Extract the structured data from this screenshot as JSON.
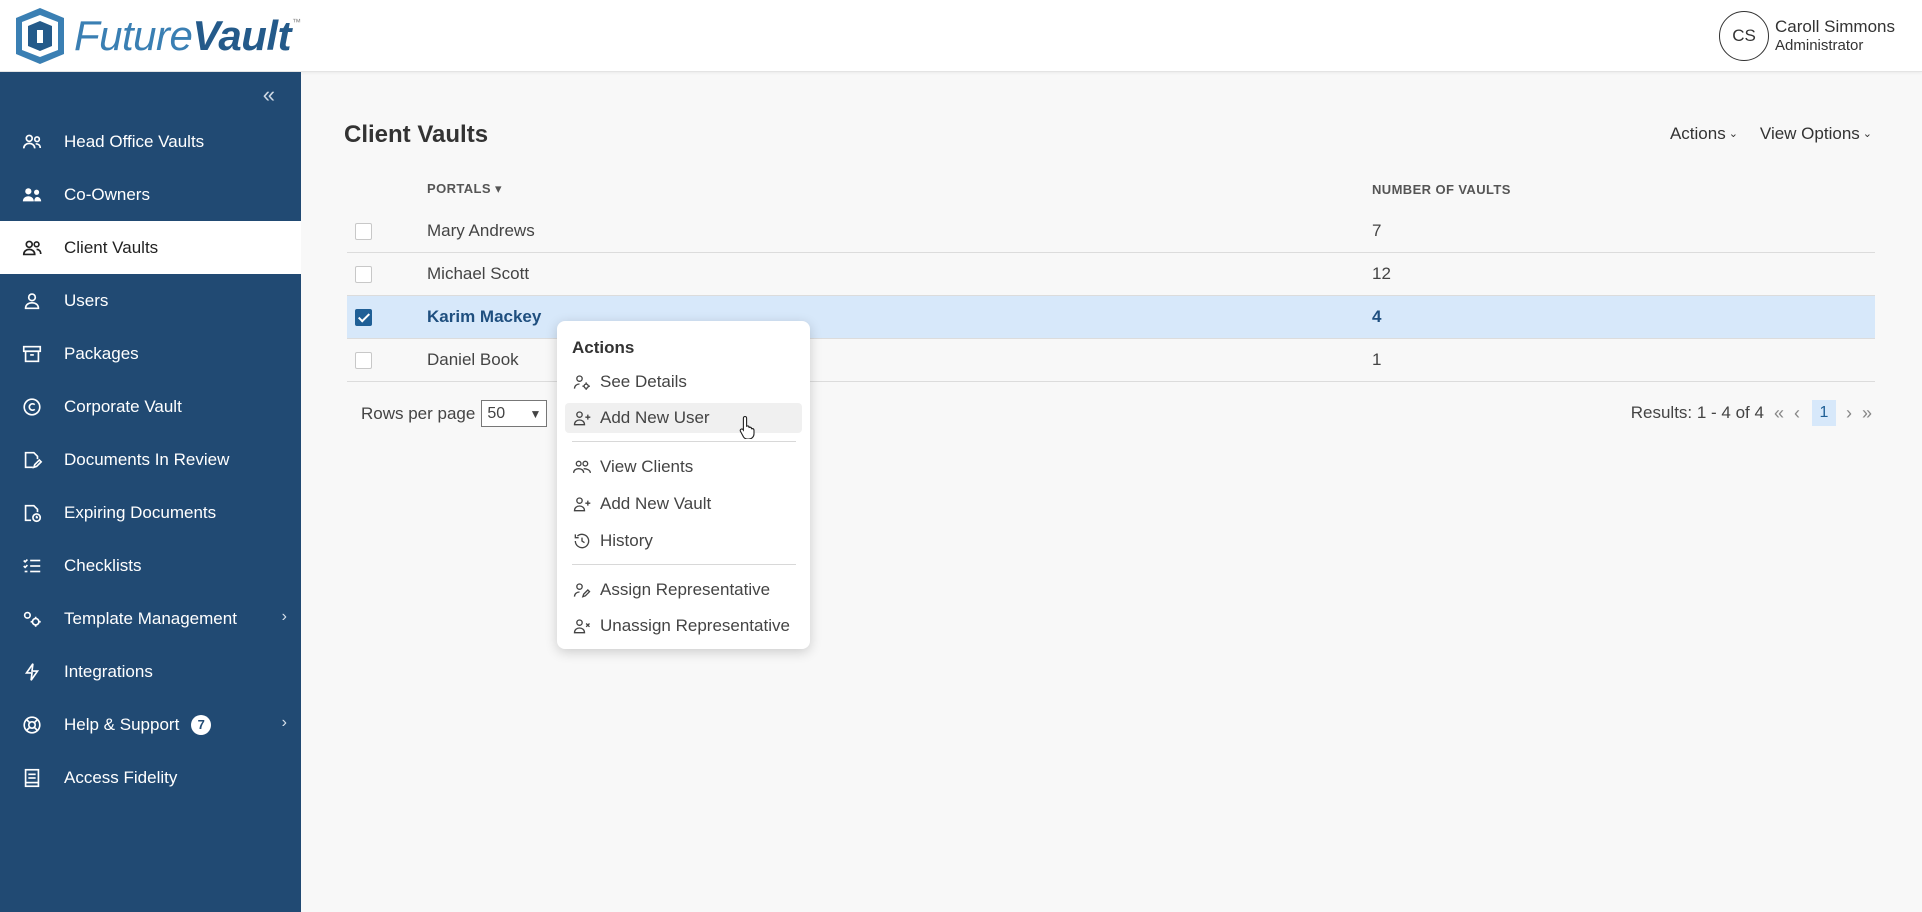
{
  "brand": {
    "name_light": "Future",
    "name_bold": "Vault",
    "tm": "™"
  },
  "user": {
    "initials": "CS",
    "name": "Caroll Simmons",
    "role": "Administrator"
  },
  "sidebar": {
    "collapse_glyph": "«",
    "items": [
      {
        "label": "Head Office Vaults",
        "icon": "users-group-icon"
      },
      {
        "label": "Co-Owners",
        "icon": "co-owners-icon"
      },
      {
        "label": "Client Vaults",
        "icon": "client-vaults-icon",
        "active": true
      },
      {
        "label": "Users",
        "icon": "user-icon"
      },
      {
        "label": "Packages",
        "icon": "package-icon"
      },
      {
        "label": "Corporate Vault",
        "icon": "copyright-icon"
      },
      {
        "label": "Documents In Review",
        "icon": "document-edit-icon"
      },
      {
        "label": "Expiring Documents",
        "icon": "document-clock-icon"
      },
      {
        "label": "Checklists",
        "icon": "checklist-icon"
      },
      {
        "label": "Template Management",
        "icon": "template-gears-icon",
        "has_submenu": true
      },
      {
        "label": "Integrations",
        "icon": "lightning-icon"
      },
      {
        "label": "Help & Support",
        "icon": "lifebuoy-icon",
        "badge": "7",
        "has_submenu": true
      },
      {
        "label": "Access Fidelity",
        "icon": "book-icon"
      }
    ]
  },
  "main": {
    "title": "Client Vaults",
    "actions_label": "Actions",
    "view_options_label": "View Options",
    "caret": "⌄",
    "table": {
      "headers": {
        "portals": "PORTALS",
        "sort_glyph": "▾",
        "vaults": "NUMBER OF VAULTS"
      },
      "rows": [
        {
          "name": "Mary Andrews",
          "vaults": "7",
          "checked": false
        },
        {
          "name": "Michael Scott",
          "vaults": "12",
          "checked": false
        },
        {
          "name": "Karim Mackey",
          "vaults": "4",
          "checked": true
        },
        {
          "name": "Daniel Book",
          "vaults": "1",
          "checked": false
        }
      ]
    },
    "footer": {
      "rows_per_page_label": "Rows per page",
      "rows_per_page_value": "50",
      "results": "Results: 1 - 4 of 4",
      "current_page": "1",
      "first_glyph": "«",
      "prev_glyph": "‹",
      "next_glyph": "›",
      "last_glyph": "»"
    }
  },
  "dropdown": {
    "title": "Actions",
    "items": [
      {
        "label": "See Details",
        "icon": "user-gear-icon"
      },
      {
        "label": "Add New User",
        "icon": "user-plus-icon",
        "hovered": true
      },
      {
        "label": "View Clients",
        "icon": "users-group-icon"
      },
      {
        "label": "Add New Vault",
        "icon": "user-plus-icon"
      },
      {
        "label": "History",
        "icon": "history-icon"
      },
      {
        "label": "Assign Representative",
        "icon": "user-edit-icon"
      },
      {
        "label": "Unassign Representative",
        "icon": "user-remove-icon"
      }
    ]
  },
  "colors": {
    "sidebar": "#214a73",
    "accent": "#1f5f96",
    "selected_row": "#d7e8fa"
  }
}
